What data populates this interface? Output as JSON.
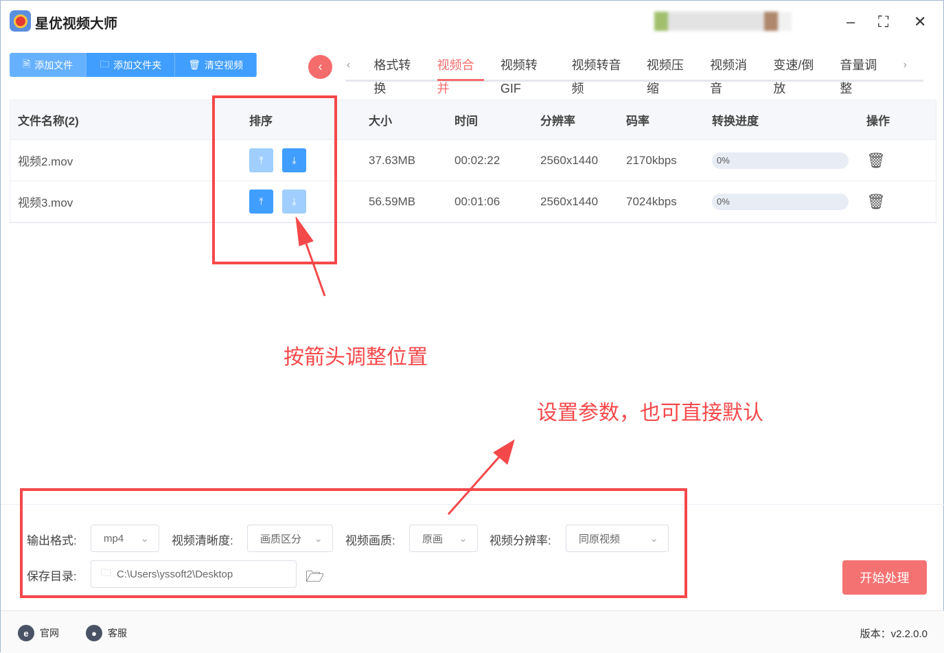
{
  "app": {
    "title": "星优视频大师"
  },
  "toolbar": {
    "add_file": "添加文件",
    "add_folder": "添加文件夹",
    "clear": "清空视频"
  },
  "tabs": [
    "格式转换",
    "视频合并",
    "视频转GIF",
    "视频转音频",
    "视频压缩",
    "视频消音",
    "变速/倒放",
    "音量调整"
  ],
  "active_tab": "视频合并",
  "table": {
    "headers": [
      "文件名称(2)",
      "排序",
      "大小",
      "时间",
      "分辨率",
      "码率",
      "转换进度",
      "操作"
    ],
    "rows": [
      {
        "name": "视频2.mov",
        "size": "37.63MB",
        "time": "00:02:22",
        "res": "2560x1440",
        "bitrate": "2170kbps",
        "progress": "0%"
      },
      {
        "name": "视频3.mov",
        "size": "56.59MB",
        "time": "00:01:06",
        "res": "2560x1440",
        "bitrate": "7024kbps",
        "progress": "0%"
      }
    ]
  },
  "settings": {
    "format_label": "输出格式:",
    "format": "mp4",
    "clarity_label": "视频清晰度:",
    "clarity": "画质区分",
    "quality_label": "视频画质:",
    "quality": "原画",
    "resolution_label": "视频分辨率:",
    "resolution": "同原视频",
    "save_label": "保存目录:",
    "save_path": "C:\\Users\\yssoft2\\Desktop"
  },
  "start_button": "开始处理",
  "footer": {
    "website": "官网",
    "support": "客服",
    "version": "版本：v2.2.0.0"
  },
  "annotations": {
    "arrows_note": "按箭头调整位置",
    "params_note": "设置参数，也可直接默认"
  },
  "colors": {
    "accent": "#409eff",
    "danger": "#f56c6c",
    "annotation": "#f5484a"
  }
}
